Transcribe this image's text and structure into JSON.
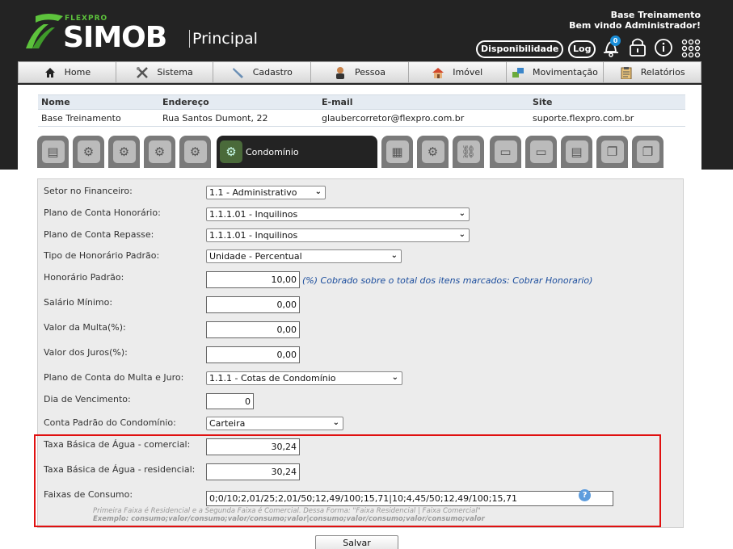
{
  "header": {
    "brand_small": "FLEXPRO",
    "brand": "SIMOB",
    "subtitle": "Principal",
    "user_line1": "Base Treinamento",
    "user_line2": "Bem vindo Administrador!",
    "btn_disponibilidade": "Disponibilidade",
    "btn_log": "Log",
    "notification_count": "0"
  },
  "nav": {
    "items": [
      {
        "label": "Home",
        "icon": "home-icon"
      },
      {
        "label": "Sistema",
        "icon": "tools-icon"
      },
      {
        "label": "Cadastro",
        "icon": "pencil-icon"
      },
      {
        "label": "Pessoa",
        "icon": "person-icon"
      },
      {
        "label": "Imóvel",
        "icon": "house-icon"
      },
      {
        "label": "Movimentação",
        "icon": "transfer-icon"
      },
      {
        "label": "Relatórios",
        "icon": "clipboard-icon"
      }
    ]
  },
  "info": {
    "headers": [
      "Nome",
      "Endereço",
      "E-mail",
      "Site"
    ],
    "values": [
      "Base Treinamento",
      "Rua Santos Dumont, 22",
      "glaubercorretor@flexpro.com.br",
      "suporte.flexpro.com.br"
    ]
  },
  "tabs": {
    "active_label": "Condomínio"
  },
  "form": {
    "setor_label": "Setor no Financeiro:",
    "setor_value": "1.1 - Administrativo",
    "plano_hon_label": "Plano de Conta Honorário:",
    "plano_hon_value": "1.1.1.01 - Inquilinos",
    "plano_rep_label": "Plano de Conta Repasse:",
    "plano_rep_value": "1.1.1.01 - Inquilinos",
    "tipo_hon_label": "Tipo de Honorário Padrão:",
    "tipo_hon_value": "Unidade - Percentual",
    "hon_padrao_label": "Honorário Padrão:",
    "hon_padrao_value": "10,00",
    "hon_padrao_hint": "(%) Cobrado sobre o total dos itens marcados: Cobrar Honorario)",
    "salario_label": "Salário Mínimo:",
    "salario_value": "0,00",
    "multa_label": "Valor da Multa(%):",
    "multa_value": "0,00",
    "juros_label": "Valor dos Juros(%):",
    "juros_value": "0,00",
    "plano_multa_label": "Plano de Conta do Multa e Juro:",
    "plano_multa_value": "1.1.1 - Cotas de Condomínio",
    "dia_label": "Dia de Vencimento:",
    "dia_value": "0",
    "conta_label": "Conta Padrão do Condomínio:",
    "conta_value": "Carteira",
    "agua_com_label": "Taxa Básica de Água - comercial:",
    "agua_com_value": "30,24",
    "agua_res_label": "Taxa Básica de Água - residencial:",
    "agua_res_value": "30,24",
    "faixas_label": "Faixas de Consumo:",
    "faixas_value": "0;0/10;2,01/25;2,01/50;12,49/100;15,71|10;4,45/50;12,49/100;15,71",
    "faixas_note1": "Primeira Faixa é Residencial e a Segunda Faixa é Comercial. Dessa Forma: \"Faixa Residencial | Faixa Comercial\"",
    "faixas_note2": "Exemplo: consumo;valor/consumo;valor/consumo;valor|consumo;valor/consumo;valor/consumo;valor",
    "save_label": "Salvar"
  }
}
